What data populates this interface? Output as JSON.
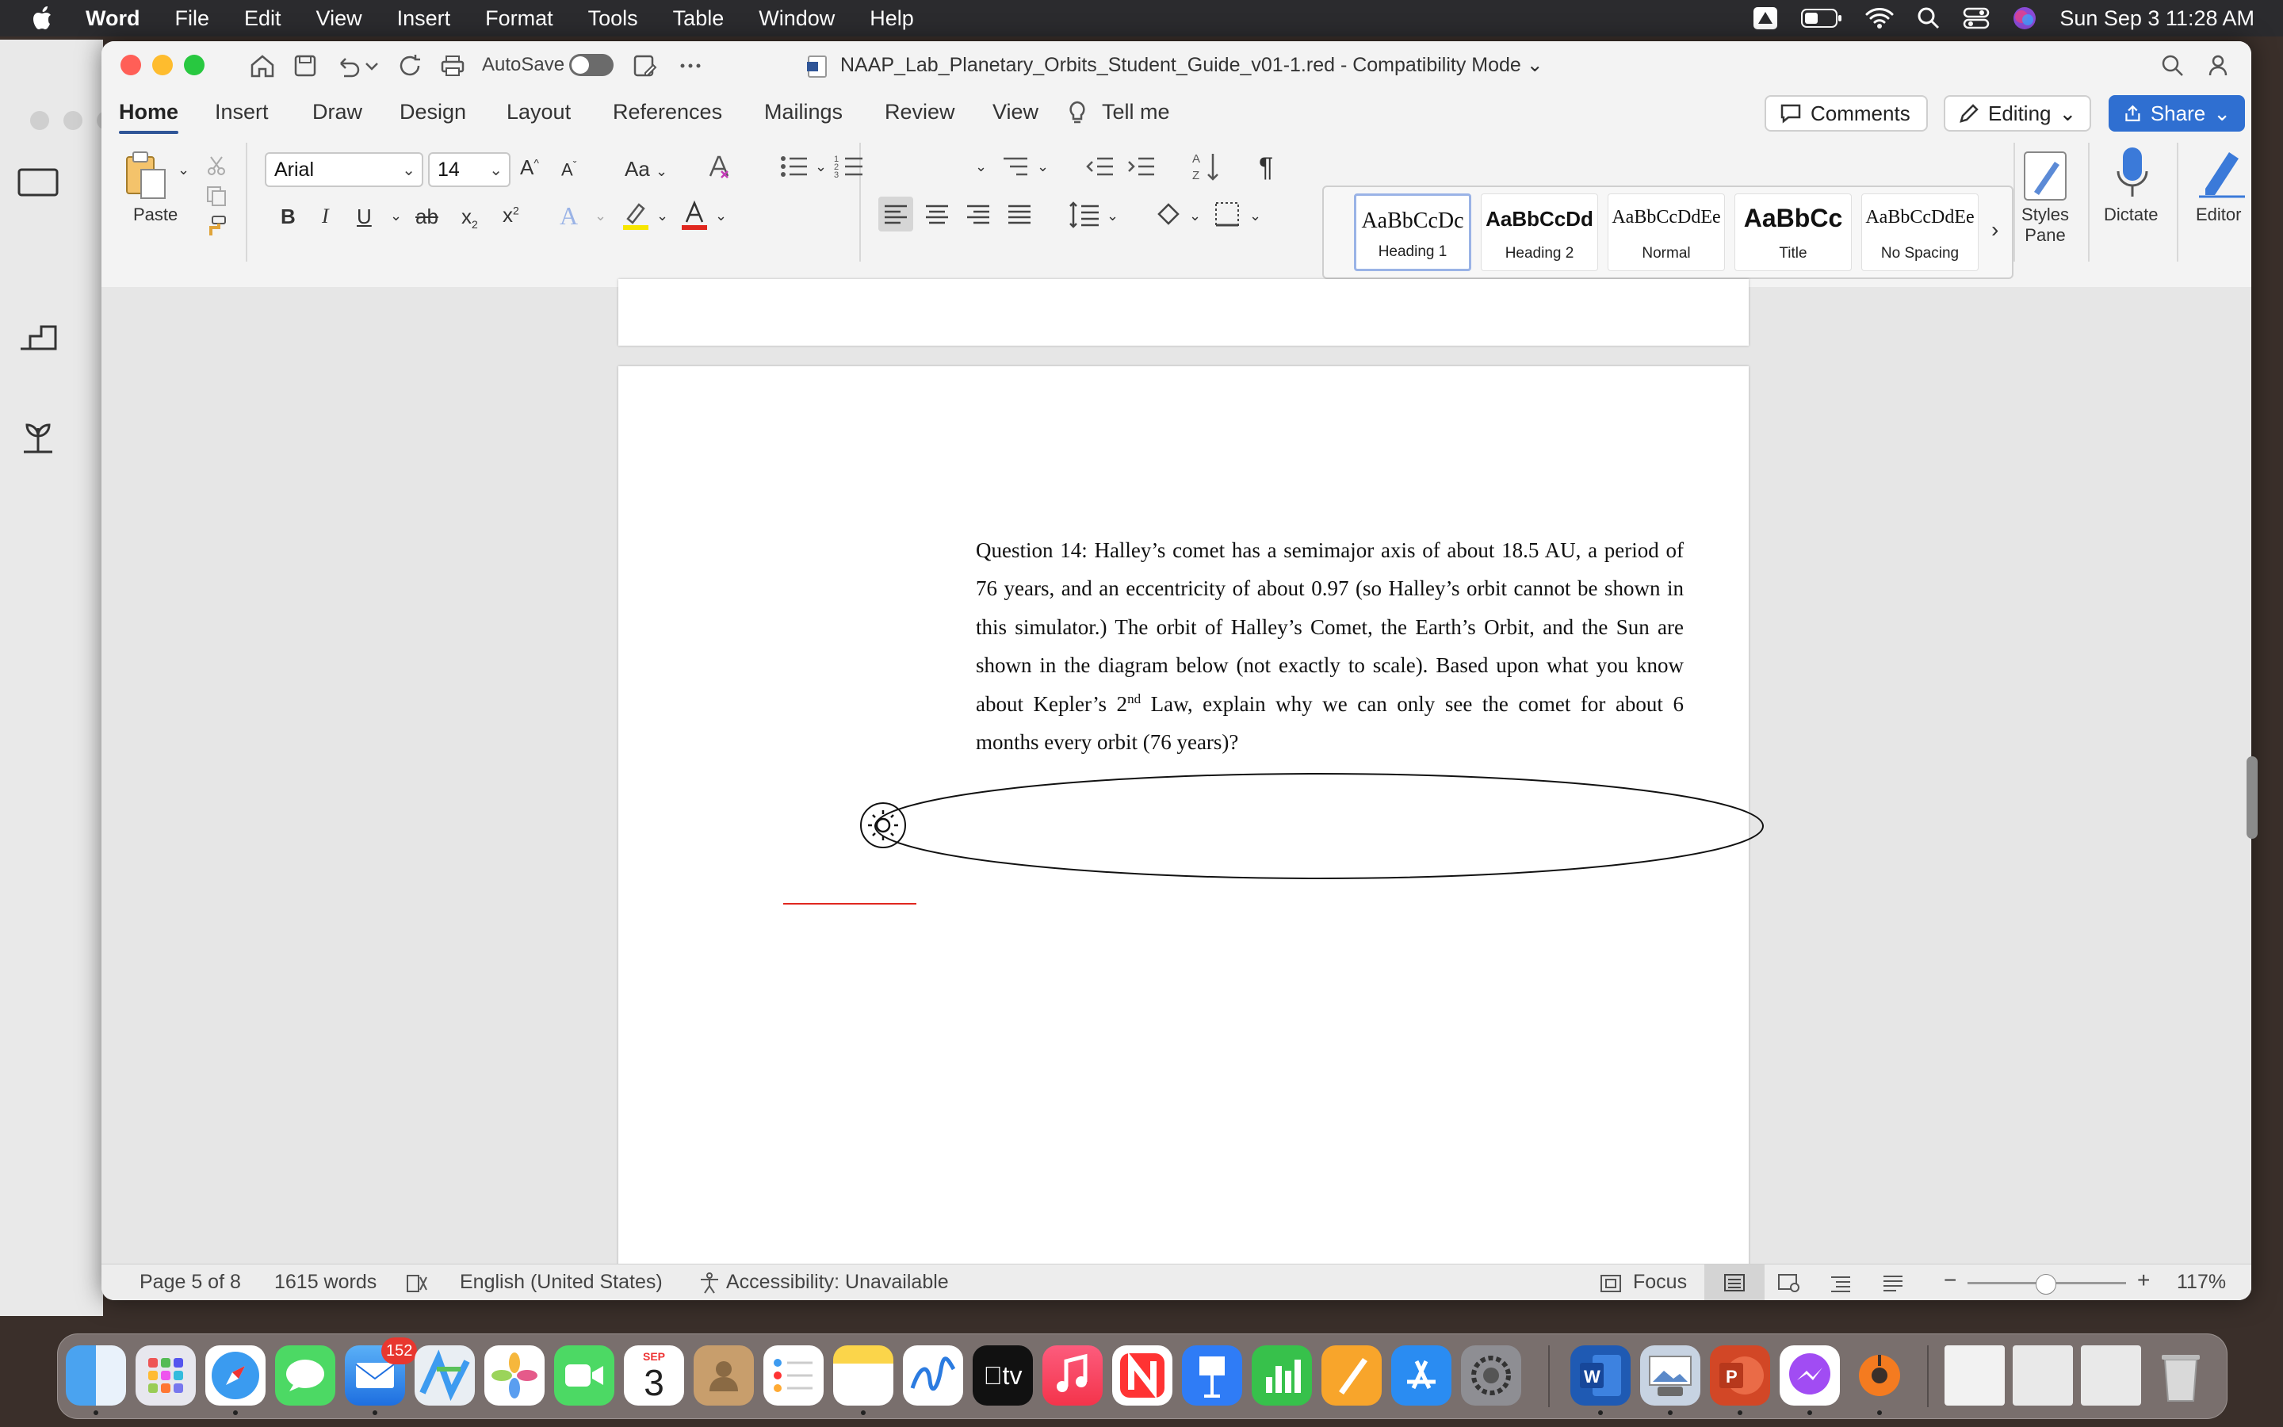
{
  "menubar": {
    "app_name": "Word",
    "items": [
      "File",
      "Edit",
      "View",
      "Insert",
      "Format",
      "Tools",
      "Table",
      "Window",
      "Help"
    ],
    "clock": "Sun Sep 3  11:28 AM"
  },
  "titlebar": {
    "autosave_label": "AutoSave",
    "document_title": "NAAP_Lab_Planetary_Orbits_Student_Guide_v01-1.red  -  Compatibility Mode"
  },
  "ribbon_tabs": [
    "Home",
    "Insert",
    "Draw",
    "Design",
    "Layout",
    "References",
    "Mailings",
    "Review",
    "View"
  ],
  "tell_me": "Tell me",
  "actions": {
    "comments": "Comments",
    "editing": "Editing",
    "share": "Share"
  },
  "ribbon": {
    "paste_label": "Paste",
    "font_name": "Arial",
    "font_size": "14",
    "change_case": "Aa",
    "styles": [
      {
        "sample": "AaBbCcDc",
        "name": "Heading 1"
      },
      {
        "sample": "AaBbCcDd",
        "name": "Heading 2"
      },
      {
        "sample": "AaBbCcDdEe",
        "name": "Normal"
      },
      {
        "sample": "AaBbCc",
        "name": "Title"
      },
      {
        "sample": "AaBbCcDdEe",
        "name": "No Spacing"
      }
    ],
    "styles_pane": "Styles Pane",
    "dictate": "Dictate",
    "editor": "Editor"
  },
  "document": {
    "question_before_sup": "Question 14: Halley’s comet has a semimajor axis of about 18.5 AU, a period of 76 years, and an eccentricity of about 0.97 (so Halley’s orbit cannot be shown in this simulator.)  The orbit of Halley’s Comet, the Earth’s Orbit, and the Sun are shown in the diagram below (not exactly to scale).  Based upon what you know about Kepler’s 2",
    "sup": "nd",
    "question_after_sup": " Law, explain why we can only see the comet for about 6 months every orbit (76 years)?"
  },
  "statusbar": {
    "page": "Page 5 of 8",
    "words": "1615 words",
    "language": "English (United States)",
    "accessibility": "Accessibility: Unavailable",
    "focus": "Focus",
    "zoom": "117%"
  },
  "dock": {
    "mail_badge": "152",
    "calendar_month": "SEP",
    "calendar_day": "3",
    "tv_label": "tv"
  },
  "colors": {
    "accent": "#2f5597",
    "share_button": "#2f6fd1",
    "font_color_bar": "#e0271f",
    "highlight_bar": "#f7e600",
    "answer_line": "#e0271f"
  }
}
